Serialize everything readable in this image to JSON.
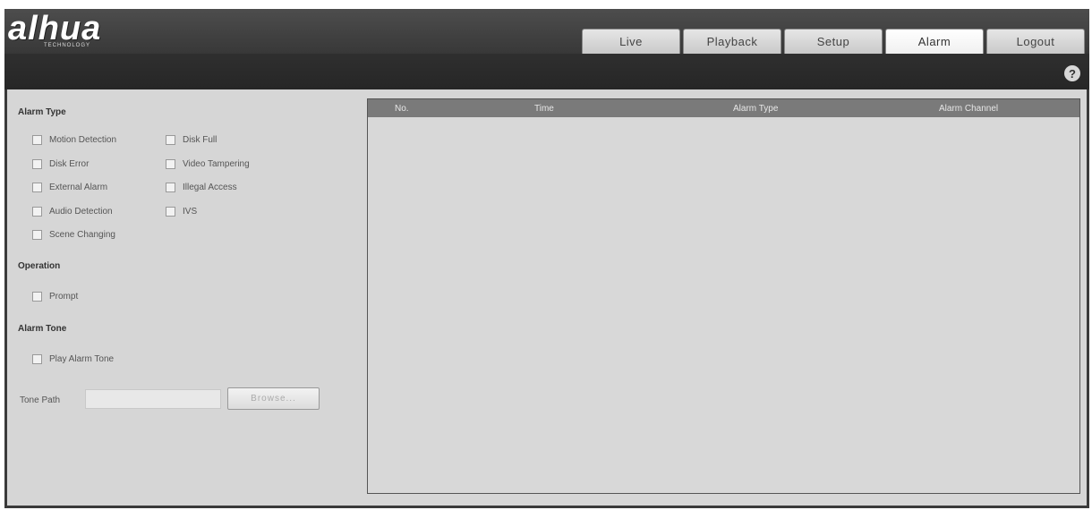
{
  "brand": {
    "logo": "alhua",
    "sub": "TECHNOLOGY"
  },
  "nav": {
    "tabs": [
      {
        "label": "Live",
        "active": false
      },
      {
        "label": "Playback",
        "active": false
      },
      {
        "label": "Setup",
        "active": false
      },
      {
        "label": "Alarm",
        "active": true
      },
      {
        "label": "Logout",
        "active": false
      }
    ]
  },
  "toolbar": {
    "help_symbol": "?"
  },
  "alarm_type": {
    "title": "Alarm Type",
    "items": [
      {
        "label": "Motion Detection",
        "checked": false
      },
      {
        "label": "Disk Full",
        "checked": false
      },
      {
        "label": "Disk Error",
        "checked": false
      },
      {
        "label": "Video Tampering",
        "checked": false
      },
      {
        "label": "External Alarm",
        "checked": false
      },
      {
        "label": "Illegal Access",
        "checked": false
      },
      {
        "label": "Audio Detection",
        "checked": false
      },
      {
        "label": "IVS",
        "checked": false
      },
      {
        "label": "Scene Changing",
        "checked": false
      }
    ]
  },
  "operation": {
    "title": "Operation",
    "items": [
      {
        "label": "Prompt",
        "checked": false
      }
    ]
  },
  "alarm_tone": {
    "title": "Alarm Tone",
    "items": [
      {
        "label": "Play Alarm Tone",
        "checked": false
      }
    ],
    "tone_path_label": "Tone Path",
    "tone_path_value": "",
    "browse_label": "Browse..."
  },
  "table": {
    "columns": [
      "No.",
      "Time",
      "Alarm Type",
      "Alarm Channel"
    ],
    "rows": []
  },
  "colors": {
    "header_bg": "#3a3a3a",
    "panel_bg": "#d6d6d6",
    "table_header_bg": "#7a7a7a"
  }
}
